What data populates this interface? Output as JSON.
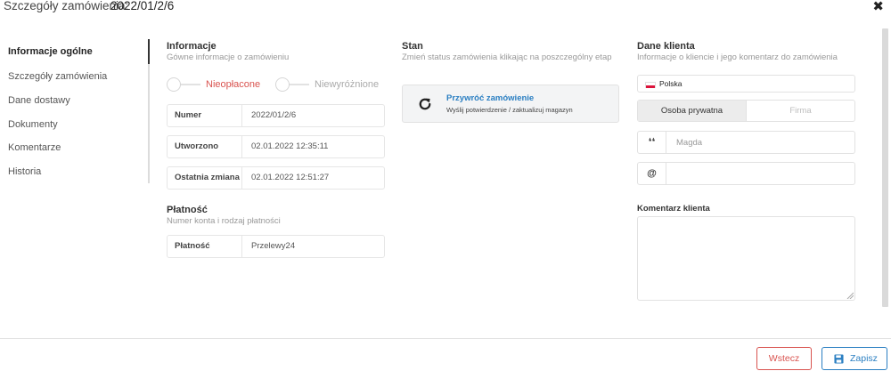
{
  "header": {
    "title_label": "Szczegóły zamówienia:",
    "title_value": "2022/01/2/6",
    "close_icon": "close-icon"
  },
  "nav": {
    "items": [
      {
        "label": "Informacje ogólne",
        "active": true
      },
      {
        "label": "Szczegóły zamówienia",
        "active": false
      },
      {
        "label": "Dane dostawy",
        "active": false
      },
      {
        "label": "Dokumenty",
        "active": false
      },
      {
        "label": "Komentarze",
        "active": false
      },
      {
        "label": "Historia",
        "active": false
      }
    ]
  },
  "info": {
    "title": "Informacje",
    "subtitle": "Gówne informacje o zamówieniu",
    "toggle_paid": {
      "label": "Nieopłacone",
      "on": false,
      "color": "#d9534f"
    },
    "toggle_featured": {
      "label": "Niewyróżnione",
      "on": false,
      "color": "#aaaaaa"
    },
    "rows": [
      {
        "key": "Numer",
        "value": "2022/01/2/6"
      },
      {
        "key": "Utworzono",
        "value": "02.01.2022 12:35:11"
      },
      {
        "key": "Ostatnia zmiana",
        "value": "02.01.2022 12:51:27"
      }
    ]
  },
  "payment": {
    "title": "Płatność",
    "subtitle": "Numer konta i rodzaj płatności",
    "key": "Płatność",
    "value": "Przelewy24"
  },
  "status": {
    "title": "Stan",
    "subtitle": "Zmień status zamówienia klikając na poszczególny etap",
    "restore_title": "Przywróć zamówienie",
    "restore_desc": "Wyślij potwierdzenie / zaktualizuj magazyn",
    "icon": "refresh-icon"
  },
  "client": {
    "title": "Dane klienta",
    "subtitle": "Informacje o kliencie i jego komentarz do zamówienia",
    "country": "Polska",
    "country_icon": "poland-flag-icon",
    "tab_private": "Osoba prywatna",
    "tab_company": "Firma",
    "name_placeholder": "Magda",
    "name_addon": "❛❛",
    "email_addon": "@",
    "email_value": "",
    "comment_label": "Komentarz klienta",
    "comment_value": ""
  },
  "footer": {
    "back_label": "Wstecz",
    "save_label": "Zapisz",
    "save_icon": "floppy-disk-icon"
  },
  "colors": {
    "accent_blue": "#2b7fc2",
    "danger_red": "#d9534f"
  }
}
